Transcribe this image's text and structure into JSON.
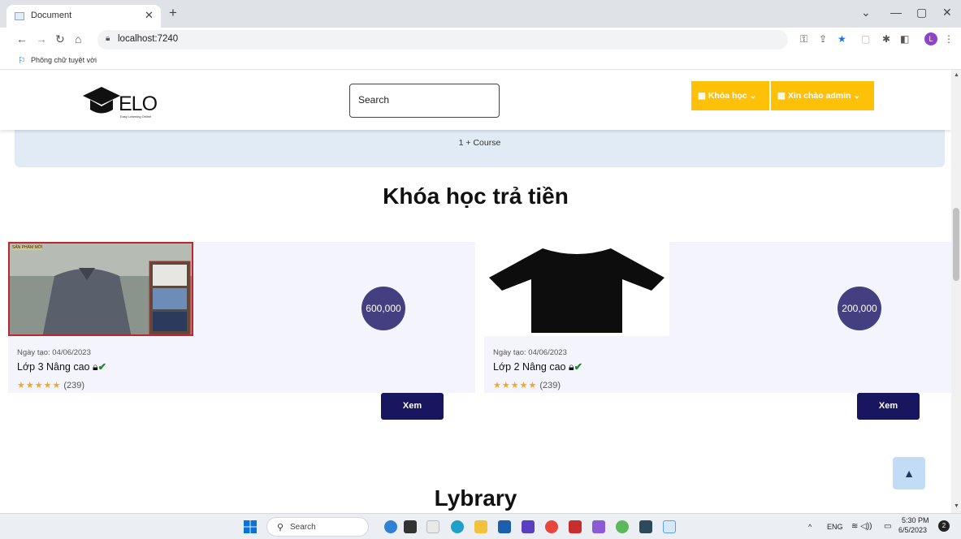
{
  "browser": {
    "tab_title": "Document",
    "url": "localhost:7240",
    "bookmark": "Phông chữ tuyệt vời",
    "profile_initial": "L"
  },
  "header": {
    "logo_text": "ELO",
    "logo_subtitle": "Easy Learning Online",
    "search_placeholder": "Search",
    "menu_courses": "Khóa học",
    "menu_user": "Xin chào admin"
  },
  "info_band": {
    "text": "1 + Course"
  },
  "section": {
    "title": "Khóa học trả tiền"
  },
  "courses": [
    {
      "image_label": "SẢN PHẨM MỚI",
      "price": "600,000",
      "created": "Ngày tạo: 04/06/2023",
      "name": "Lớp 3 Nâng cao",
      "reviews": "(239)",
      "rating_stars": 5,
      "view_label": "Xem"
    },
    {
      "image_label": "",
      "price": "200,000",
      "created": "Ngày tạo: 04/06/2023",
      "name": "Lớp 2 Nâng cao",
      "reviews": "(239)",
      "rating_stars": 5,
      "view_label": "Xem"
    }
  ],
  "next_section": {
    "title": "Lybrary"
  },
  "taskbar": {
    "search_label": "Search",
    "language": "ENG",
    "time": "5:30 PM",
    "date": "6/5/2023"
  },
  "colors": {
    "accent_yellow": "#ffc107",
    "price_circle": "#443f80",
    "button_navy": "#17165e",
    "info_band": "#e1ebf6"
  }
}
